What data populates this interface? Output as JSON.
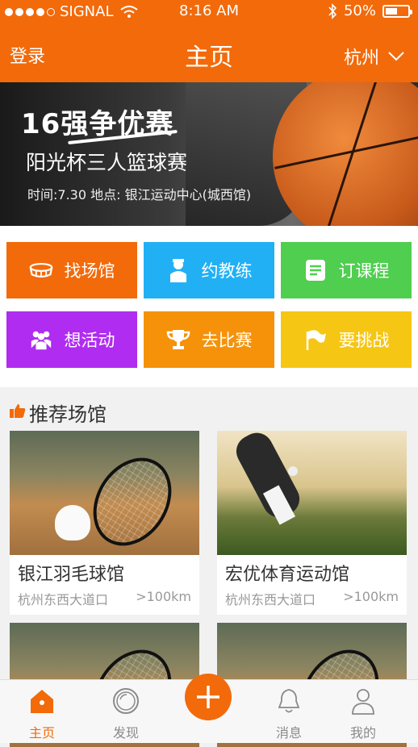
{
  "status": {
    "carrier": "SIGNAL",
    "time": "8:16 AM",
    "battery": "50%"
  },
  "nav": {
    "login": "登录",
    "title": "主页",
    "city": "杭州"
  },
  "banner": {
    "headline": "16强争优赛",
    "subtitle": "阳光杯三人篮球赛",
    "info": "时间:7.30  地点: 银江运动中心(城西馆)"
  },
  "actions": [
    {
      "label": "找场馆",
      "icon": "stadium-icon",
      "color": "#f26a0a"
    },
    {
      "label": "约教练",
      "icon": "coach-icon",
      "color": "#22b0f5"
    },
    {
      "label": "订课程",
      "icon": "course-icon",
      "color": "#4fce4f"
    },
    {
      "label": "想活动",
      "icon": "group-icon",
      "color": "#b02cf0"
    },
    {
      "label": "去比赛",
      "icon": "trophy-icon",
      "color": "#f5920a"
    },
    {
      "label": "要挑战",
      "icon": "flag-icon",
      "color": "#f6c614"
    }
  ],
  "section": {
    "title": "推荐场馆"
  },
  "venues": [
    {
      "name": "银江羽毛球馆",
      "address": "杭州东西大道口",
      "distance": ">100km"
    },
    {
      "name": "宏优体育运动馆",
      "address": "杭州东西大道口",
      "distance": ">100km"
    }
  ],
  "tabs": [
    {
      "label": "主页",
      "icon": "home-icon"
    },
    {
      "label": "发现",
      "icon": "discover-icon"
    },
    {
      "label": "",
      "icon": "plus-icon"
    },
    {
      "label": "消息",
      "icon": "bell-icon"
    },
    {
      "label": "我的",
      "icon": "user-icon"
    }
  ],
  "colors": {
    "brand": "#f26a0a"
  }
}
